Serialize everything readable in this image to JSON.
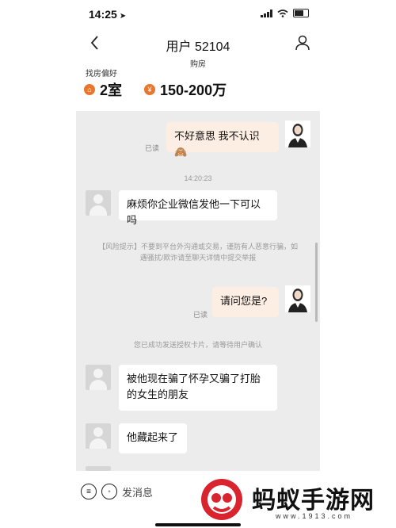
{
  "status": {
    "time": "14:25"
  },
  "nav": {
    "title": "用户 52104",
    "subtitle": "购房"
  },
  "preferences": {
    "label": "找房偏好",
    "rooms": "2室",
    "budget": "150-200万"
  },
  "chat": {
    "messages": [
      {
        "text": "不好意思 我不认识🙈",
        "read": "已读"
      },
      {
        "timestamp": "14:20:23"
      },
      {
        "text": "麻烦你企业微信发他一下可以吗"
      },
      {
        "system": "【风险提示】不要到平台外沟通或交易，谨防有人恶意行骗，如遇骚扰/欺诈请至聊天详情中提交举报"
      },
      {
        "text": "请问您是?",
        "read": "已读"
      },
      {
        "system": "您已成功发送授权卡片，请等待用户确认"
      },
      {
        "text": "被他现在骗了怀孕又骗了打胎的女生的朋友"
      },
      {
        "text": "他藏起来了"
      }
    ]
  },
  "bottom": {
    "input_placeholder": "发消息"
  },
  "watermark": {
    "text": "蚂蚁手游网",
    "url": "www.1913.com"
  },
  "colors": {
    "accent": "#e8772e",
    "outgoing_bubble": "#fdeee4",
    "chat_bg": "#ececec"
  }
}
